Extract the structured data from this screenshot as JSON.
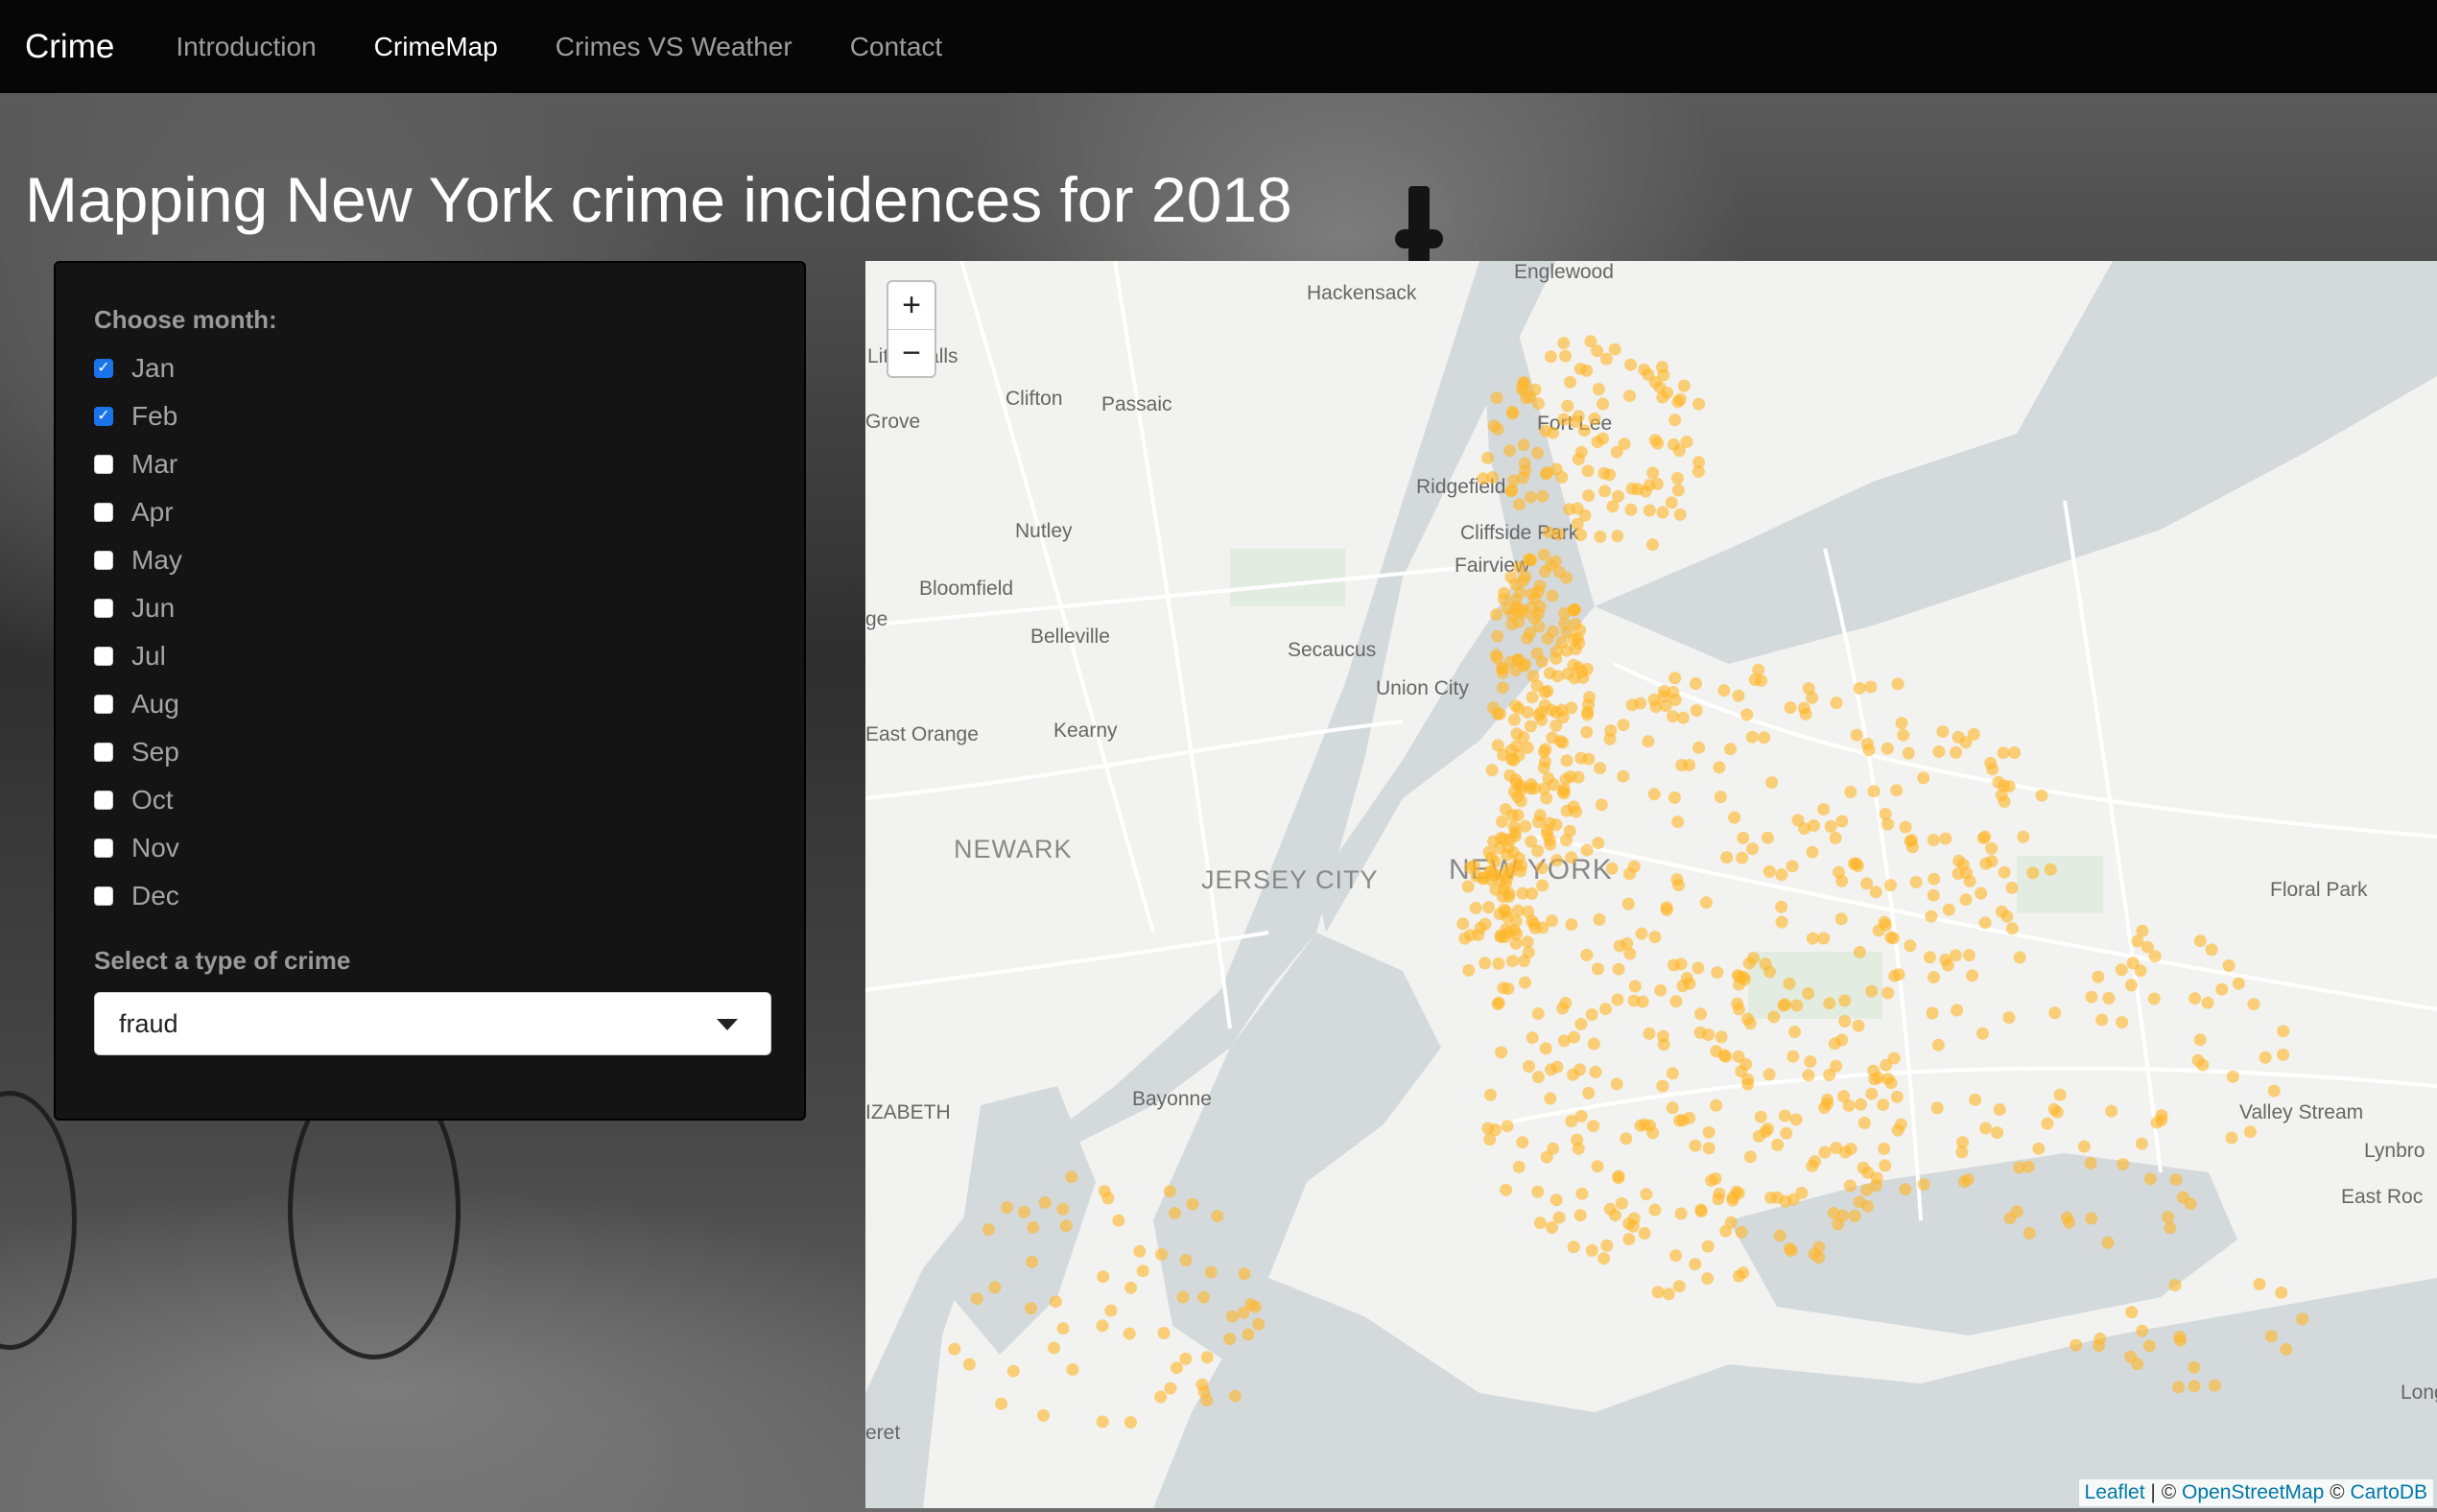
{
  "navbar": {
    "brand": "Crime",
    "items": [
      {
        "label": "Introduction",
        "active": false
      },
      {
        "label": "CrimeMap",
        "active": true
      },
      {
        "label": "Crimes VS Weather",
        "active": false
      },
      {
        "label": "Contact",
        "active": false
      }
    ]
  },
  "page": {
    "title": "Mapping New York crime incidences for 2018"
  },
  "sidebar": {
    "month_label": "Choose month:",
    "months": [
      {
        "label": "Jan",
        "checked": true
      },
      {
        "label": "Feb",
        "checked": true
      },
      {
        "label": "Mar",
        "checked": false
      },
      {
        "label": "Apr",
        "checked": false
      },
      {
        "label": "May",
        "checked": false
      },
      {
        "label": "Jun",
        "checked": false
      },
      {
        "label": "Jul",
        "checked": false
      },
      {
        "label": "Aug",
        "checked": false
      },
      {
        "label": "Sep",
        "checked": false
      },
      {
        "label": "Oct",
        "checked": false
      },
      {
        "label": "Nov",
        "checked": false
      },
      {
        "label": "Dec",
        "checked": false
      }
    ],
    "crime_label": "Select a type of crime",
    "crime_value": "fraud"
  },
  "map": {
    "zoom_in": "+",
    "zoom_out": "−",
    "places": {
      "hackensack": "Hackensack",
      "englewood": "Englewood",
      "little_falls": "Little Falls",
      "clifton": "Clifton",
      "passaic": "Passaic",
      "grove": "Grove",
      "fort_lee": "Fort Lee",
      "ridgefield": "Ridgefield",
      "cliffside_park": "Cliffside Park",
      "fairview": "Fairview",
      "nutley": "Nutley",
      "bloomfield": "Bloomfield",
      "ge": "ge",
      "belleville": "Belleville",
      "secaucus": "Secaucus",
      "union_city": "Union City",
      "east_orange": "East Orange",
      "kearny": "Kearny",
      "newark": "NEWARK",
      "jersey_city": "JERSEY CITY",
      "new_york": "NEW YORK",
      "floral_park": "Floral Park",
      "elizabeth": "IZABETH",
      "bayonne": "Bayonne",
      "valley_stream": "Valley Stream",
      "lynbrook": "Lynbro",
      "east_rockaway": "East Roc",
      "long": "Long",
      "eret": "eret"
    },
    "attribution": {
      "leaflet": "Leaflet",
      "sep": "| ©",
      "osm": "OpenStreetMap",
      "sep2": "©",
      "carto": "CartoDB"
    },
    "colors": {
      "marker": "#ffb627",
      "water": "#d4dadc",
      "land": "#f2f2f0",
      "road": "#ffffff"
    }
  }
}
